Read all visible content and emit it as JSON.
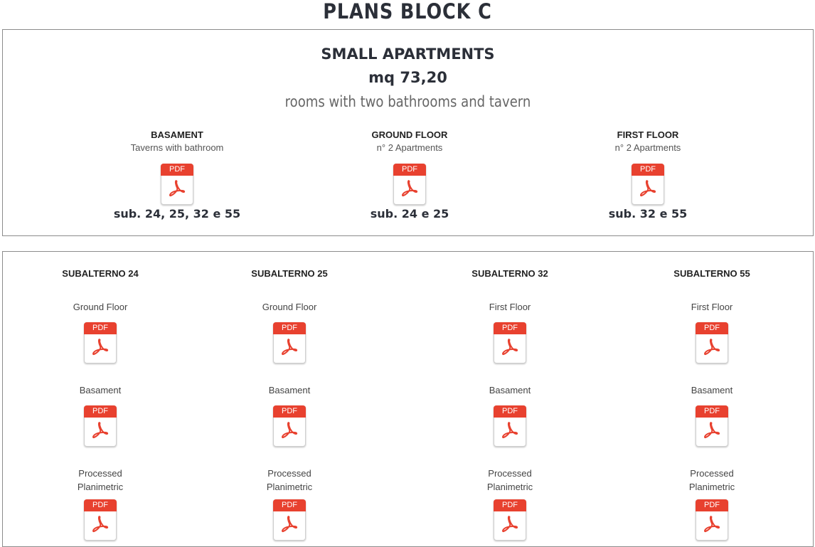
{
  "page": {
    "title": "PLANS BLOCK C"
  },
  "summary": {
    "title": "SMALL APARTMENTS",
    "size": "mq 73,20",
    "description": "rooms with two bathrooms and tavern",
    "plans": [
      {
        "heading": "BASAMENT",
        "sub": "Taverns with bathroom",
        "pdf_label": "PDF",
        "units": "sub. 24, 25, 32 e 55"
      },
      {
        "heading": "GROUND FLOOR",
        "sub": "n° 2  Apartments",
        "pdf_label": "PDF",
        "units": "sub. 24 e 25"
      },
      {
        "heading": "FIRST FLOOR",
        "sub": "n° 2 Apartments",
        "pdf_label": "PDF",
        "units": "sub. 32 e 55"
      }
    ]
  },
  "subalterni": [
    {
      "heading": "SUBALTERNO 24",
      "items": [
        {
          "label": "Ground Floor",
          "pdf_label": "PDF"
        },
        {
          "label": "Basament",
          "pdf_label": "PDF"
        },
        {
          "label": "Processed\nPlanimetric",
          "pdf_label": "PDF"
        }
      ]
    },
    {
      "heading": "SUBALTERNO 25",
      "items": [
        {
          "label": "Ground Floor",
          "pdf_label": "PDF"
        },
        {
          "label": "Basament",
          "pdf_label": "PDF"
        },
        {
          "label": "Processed\nPlanimetric",
          "pdf_label": "PDF"
        }
      ]
    },
    {
      "heading": "SUBALTERNO 32",
      "items": [
        {
          "label": "First Floor",
          "pdf_label": "PDF"
        },
        {
          "label": "Basament",
          "pdf_label": "PDF"
        },
        {
          "label": "Processed\nPlanimetric",
          "pdf_label": "PDF"
        }
      ]
    },
    {
      "heading": "SUBALTERNO 55",
      "items": [
        {
          "label": "First Floor",
          "pdf_label": "PDF"
        },
        {
          "label": "Basament",
          "pdf_label": "PDF"
        },
        {
          "label": "Processed\nPlanimetric",
          "pdf_label": "PDF"
        }
      ]
    }
  ],
  "colors": {
    "pdf_red": "#e8412f",
    "title": "#2b2f38",
    "border": "#8c8c8c"
  },
  "icons": {
    "pdf": "pdf-file-icon"
  }
}
